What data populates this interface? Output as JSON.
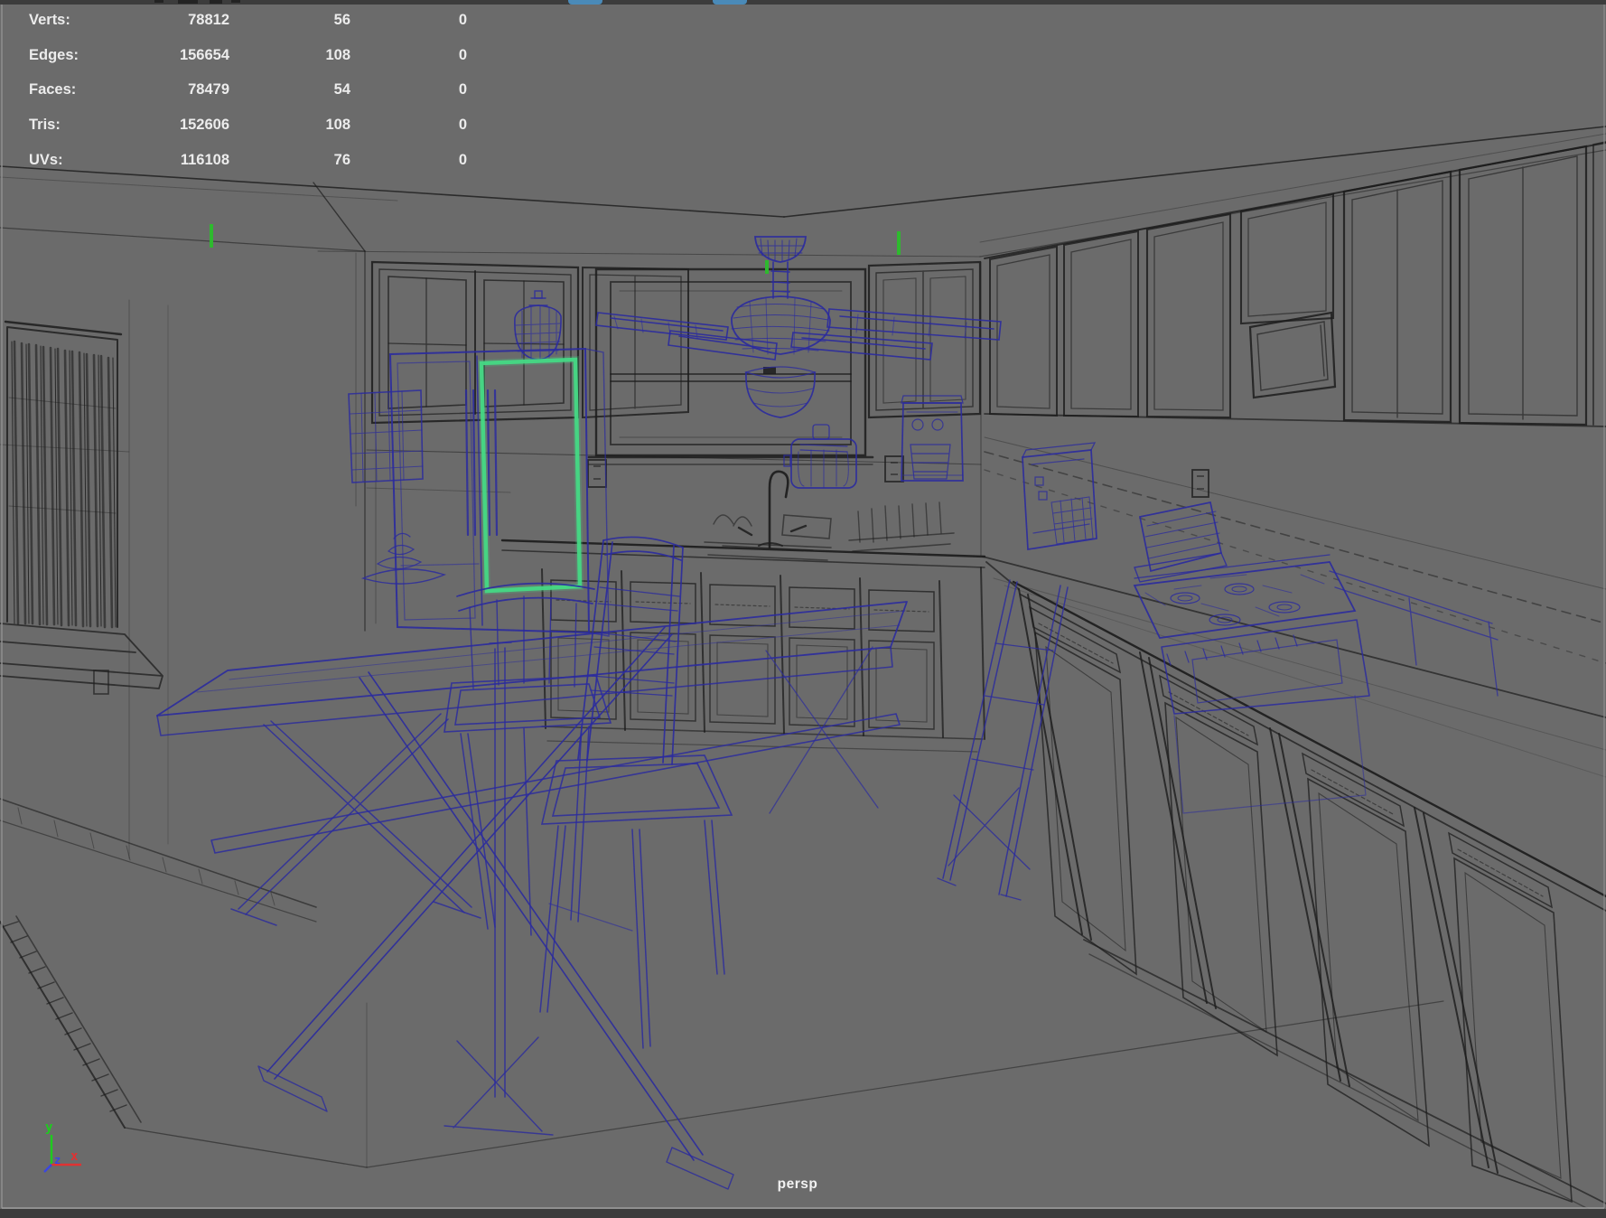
{
  "viewport": {
    "camera_label": "persp",
    "background_color": "#6b6b6b",
    "wireframe_black": "#1c1c1c",
    "wireframe_blue": "#2b2b9e",
    "selection_highlight_green": "#44d884",
    "locator_green": "#2eb92e",
    "chrome_bar_color": "#3c3c3c"
  },
  "heads_up_display": {
    "rows": [
      {
        "label": "Verts:",
        "total": "78812",
        "selected": "56",
        "extra": "0"
      },
      {
        "label": "Edges:",
        "total": "156654",
        "selected": "108",
        "extra": "0"
      },
      {
        "label": "Faces:",
        "total": "78479",
        "selected": "54",
        "extra": "0"
      },
      {
        "label": "Tris:",
        "total": "152606",
        "selected": "108",
        "extra": "0"
      },
      {
        "label": "UVs:",
        "total": "116108",
        "selected": "76",
        "extra": "0"
      }
    ]
  },
  "axis_gizmo": {
    "x_label": "x",
    "y_label": "y",
    "z_label": "z",
    "x_color": "#e03232",
    "y_color": "#1ecb1e",
    "z_color": "#3a46e0"
  }
}
